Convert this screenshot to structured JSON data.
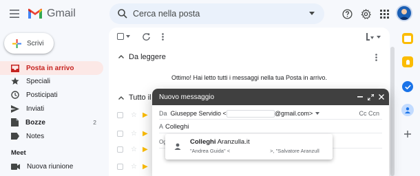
{
  "app": {
    "name": "Gmail"
  },
  "search": {
    "placeholder": "Cerca nella posta"
  },
  "compose_button": {
    "label": "Scrivi"
  },
  "sidebar": {
    "items": [
      {
        "label": "Posta in arrivo",
        "count": "",
        "active": true
      },
      {
        "label": "Speciali",
        "count": ""
      },
      {
        "label": "Posticipati",
        "count": ""
      },
      {
        "label": "Inviati",
        "count": ""
      },
      {
        "label": "Bozze",
        "count": "2"
      },
      {
        "label": "Notes",
        "count": ""
      }
    ],
    "meet": {
      "title": "Meet",
      "new_meeting": "Nuova riunione"
    }
  },
  "sections": {
    "unread_title": "Da leggere",
    "unread_message": "Ottimo! Hai letto tutti i messaggi nella tua Posta in arrivo.",
    "all_title": "Tutto il"
  },
  "compose_window": {
    "title": "Nuovo messaggio",
    "from_label": "Da",
    "from_name": "Giuseppe Servidio <",
    "from_domain": "@gmail.com>",
    "cc_label": "Cc Ccn",
    "to_label": "A",
    "to_value": "Colleghi",
    "subject_prefix": "Og"
  },
  "suggestion": {
    "name": "Colleghi",
    "domain": " Aranzulla.it",
    "members": "\"Andrea Guida\" <",
    "members_tail": ">, \"Salvatore Aranzull"
  },
  "colors": {
    "accent_red": "#c5221f",
    "active_bg": "#fce8e6",
    "compose_header": "#404040"
  }
}
